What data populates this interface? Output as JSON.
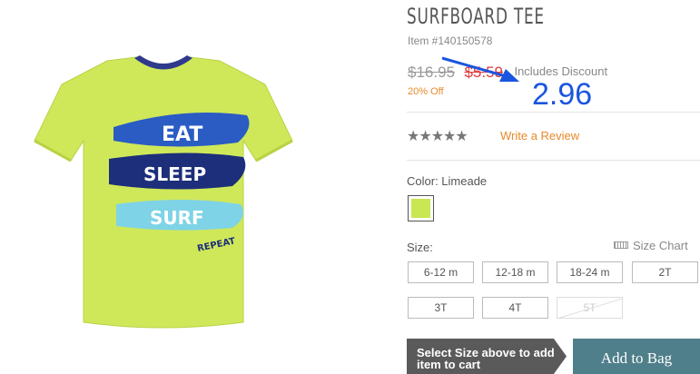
{
  "product": {
    "title": "SURFBOARD TEE",
    "item_number": "Item #140150578",
    "price_original": "$16.95",
    "price_sale": "$5.59",
    "includes_discount": "Includes Discount",
    "percent_off": "20% Off",
    "rating_stars": "★★★★★",
    "rating_value": 0,
    "write_review": "Write a Review",
    "color_label": "Color: Limeade",
    "size_label": "Size:",
    "size_chart": "Size Chart",
    "sizes": [
      "6-12 m",
      "12-18 m",
      "18-24 m",
      "2T",
      "3T",
      "4T",
      "5T"
    ],
    "sizes_disabled": [
      "5T"
    ],
    "cart_note": "Select Size above to add item to cart",
    "add_to_bag": "Add to Bag",
    "image_text": [
      "EAT",
      "SLEEP",
      "SURF",
      "REPEAT"
    ]
  },
  "annotation": {
    "number": "2.96",
    "color": "#1a55e0"
  },
  "colors": {
    "sale_red": "#e03a3a",
    "accent_orange": "#e8892b",
    "swatch_limeade": "#c9e653",
    "button_teal": "#4f7f8a",
    "note_gray": "#5a5a5a"
  }
}
